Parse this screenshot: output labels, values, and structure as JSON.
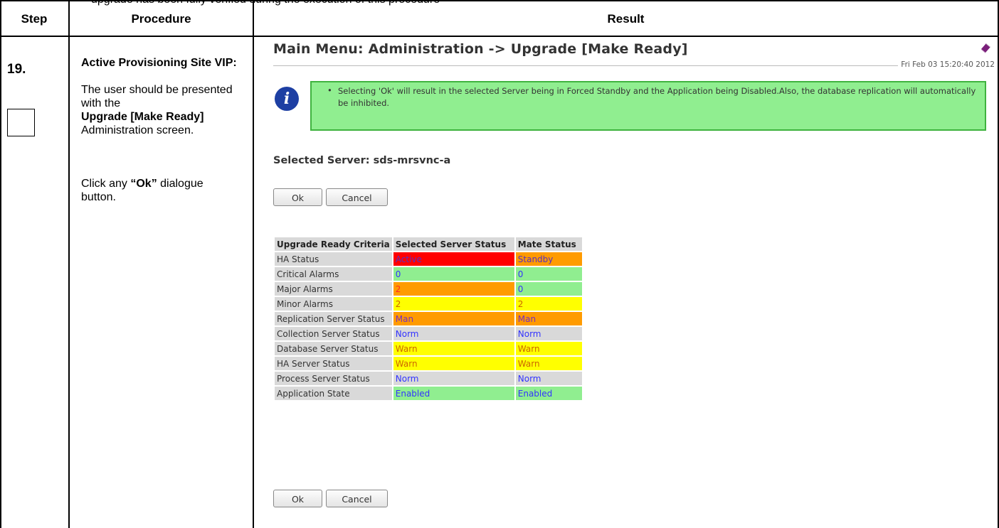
{
  "caption": "upgrade has been fully verified during the execution of this procedure",
  "header": {
    "step": "Step",
    "procedure": "Procedure",
    "result": "Result"
  },
  "step": {
    "number": "19."
  },
  "procedure": {
    "title": "Active Provisioning Site VIP:",
    "line1": "The user should be presented with the",
    "bold1": "Upgrade [Make Ready]",
    "line2": "Administration screen.",
    "click_prefix": "Click any ",
    "click_bold": "“Ok”",
    "click_suffix": " dialogue button."
  },
  "screen": {
    "title": "Main Menu: Administration -> Upgrade [Make Ready]",
    "datetime": "Fri Feb 03 15:20:40 2012",
    "info_message": "Selecting 'Ok' will result in the selected Server being in Forced Standby and the Application being Disabled.Also, the database replication will automatically be inhibited.",
    "selected_server": "Selected Server: sds-mrsvnc-a",
    "ok_label": "Ok",
    "cancel_label": "Cancel",
    "columns": [
      "Upgrade Ready Criteria",
      "Selected Server Status",
      "Mate Status"
    ],
    "rows": [
      {
        "label": "HA Status",
        "sel": "Active",
        "sel_bg": "#ff0000",
        "sel_fg": "#5a2fbf",
        "mate": "Standby",
        "mate_bg": "#ff9b00",
        "mate_fg": "#5a2fbf"
      },
      {
        "label": "Critical Alarms",
        "sel": "0",
        "sel_bg": "#90ee90",
        "sel_fg": "#3333ff",
        "mate": "0",
        "mate_bg": "#90ee90",
        "mate_fg": "#3333ff"
      },
      {
        "label": "Major Alarms",
        "sel": "2",
        "sel_bg": "#ff9b00",
        "sel_fg": "#ff2a2a",
        "mate": "0",
        "mate_bg": "#90ee90",
        "mate_fg": "#3333ff"
      },
      {
        "label": "Minor Alarms",
        "sel": "2",
        "sel_bg": "#ffff00",
        "sel_fg": "#cc6600",
        "mate": "2",
        "mate_bg": "#ffff00",
        "mate_fg": "#cc6600"
      },
      {
        "label": "Replication Server Status",
        "sel": "Man",
        "sel_bg": "#ff9b00",
        "sel_fg": "#7a2fbf",
        "mate": "Man",
        "mate_bg": "#ff9b00",
        "mate_fg": "#7a2fbf"
      },
      {
        "label": "Collection Server Status",
        "sel": "Norm",
        "sel_bg": "#d9d9d9",
        "sel_fg": "#3333ff",
        "mate": "Norm",
        "mate_bg": "#d9d9d9",
        "mate_fg": "#3333ff"
      },
      {
        "label": "Database Server Status",
        "sel": "Warn",
        "sel_bg": "#ffff00",
        "sel_fg": "#cc6600",
        "mate": "Warn",
        "mate_bg": "#ffff00",
        "mate_fg": "#cc6600"
      },
      {
        "label": "HA Server Status",
        "sel": "Warn",
        "sel_bg": "#ffff00",
        "sel_fg": "#cc6600",
        "mate": "Warn",
        "mate_bg": "#ffff00",
        "mate_fg": "#cc6600"
      },
      {
        "label": "Process Server Status",
        "sel": "Norm",
        "sel_bg": "#d9d9d9",
        "sel_fg": "#3333ff",
        "mate": "Norm",
        "mate_bg": "#d9d9d9",
        "mate_fg": "#3333ff"
      },
      {
        "label": "Application State",
        "sel": "Enabled",
        "sel_bg": "#90ee90",
        "sel_fg": "#3333ff",
        "mate": "Enabled",
        "mate_bg": "#90ee90",
        "mate_fg": "#3333ff"
      }
    ]
  },
  "icons": {
    "info": "info-icon",
    "help": "help-book-icon"
  }
}
